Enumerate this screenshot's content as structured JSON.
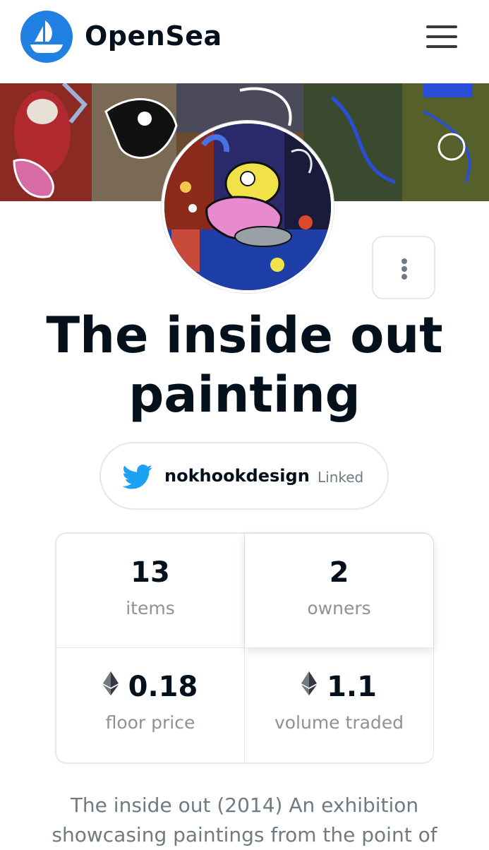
{
  "header": {
    "brand": "OpenSea",
    "logo_icon": "opensea-sailboat-icon",
    "menu_icon": "hamburger-menu-icon",
    "accent_color": "#2081e2"
  },
  "collection": {
    "title_line1": "The inside out",
    "title_line2": "painting",
    "more_icon": "vertical-ellipsis-icon",
    "twitter": {
      "icon": "twitter-bird-icon",
      "handle": "nokhookdesign",
      "status": "Linked",
      "color": "#1da1f2"
    },
    "stats": {
      "items_value": "13",
      "items_label": "items",
      "owners_value": "2",
      "owners_label": "owners",
      "floor_value": "0.18",
      "floor_label": "floor price",
      "volume_value": "1.1",
      "volume_label": "volume traded",
      "currency_icon": "ethereum-icon"
    },
    "description_line1": "The inside out (2014) An exhibition",
    "description_line2": "showcasing paintings from the point of"
  }
}
